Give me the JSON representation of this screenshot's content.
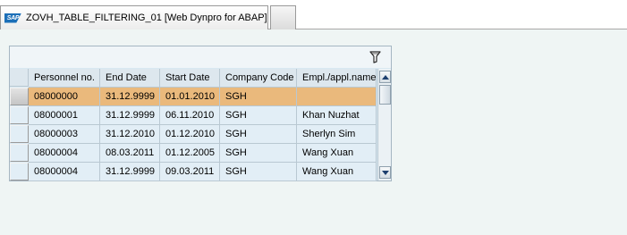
{
  "tab": {
    "logo_text": "SAP",
    "title": "ZOVH_TABLE_FILTERING_01 [Web Dynpro for ABAP]"
  },
  "table": {
    "toolbar": {
      "filter_icon": "filter-icon"
    },
    "columns": [
      "Personnel no.",
      "End Date",
      "Start Date",
      "Company Code",
      "Empl./appl.name"
    ],
    "rows": [
      {
        "personnel_no": "08000000",
        "end_date": "31.12.9999",
        "start_date": "01.01.2010",
        "company_code": "SGH",
        "name": "",
        "selected": true
      },
      {
        "personnel_no": "08000001",
        "end_date": "31.12.9999",
        "start_date": "06.11.2010",
        "company_code": "SGH",
        "name": "Khan Nuzhat",
        "selected": false
      },
      {
        "personnel_no": "08000003",
        "end_date": "31.12.2010",
        "start_date": "01.12.2010",
        "company_code": "SGH",
        "name": "Sherlyn Sim",
        "selected": false
      },
      {
        "personnel_no": "08000004",
        "end_date": "08.03.2011",
        "start_date": "01.12.2005",
        "company_code": "SGH",
        "name": "Wang Xuan",
        "selected": false
      },
      {
        "personnel_no": "08000004",
        "end_date": "31.12.9999",
        "start_date": "09.03.2011",
        "company_code": "SGH",
        "name": "Wang Xuan",
        "selected": false
      }
    ]
  },
  "colors": {
    "background": "#eff5f4",
    "selected_row": "#eab97c",
    "row": "#e2eef6",
    "header": "#dde7ee"
  }
}
